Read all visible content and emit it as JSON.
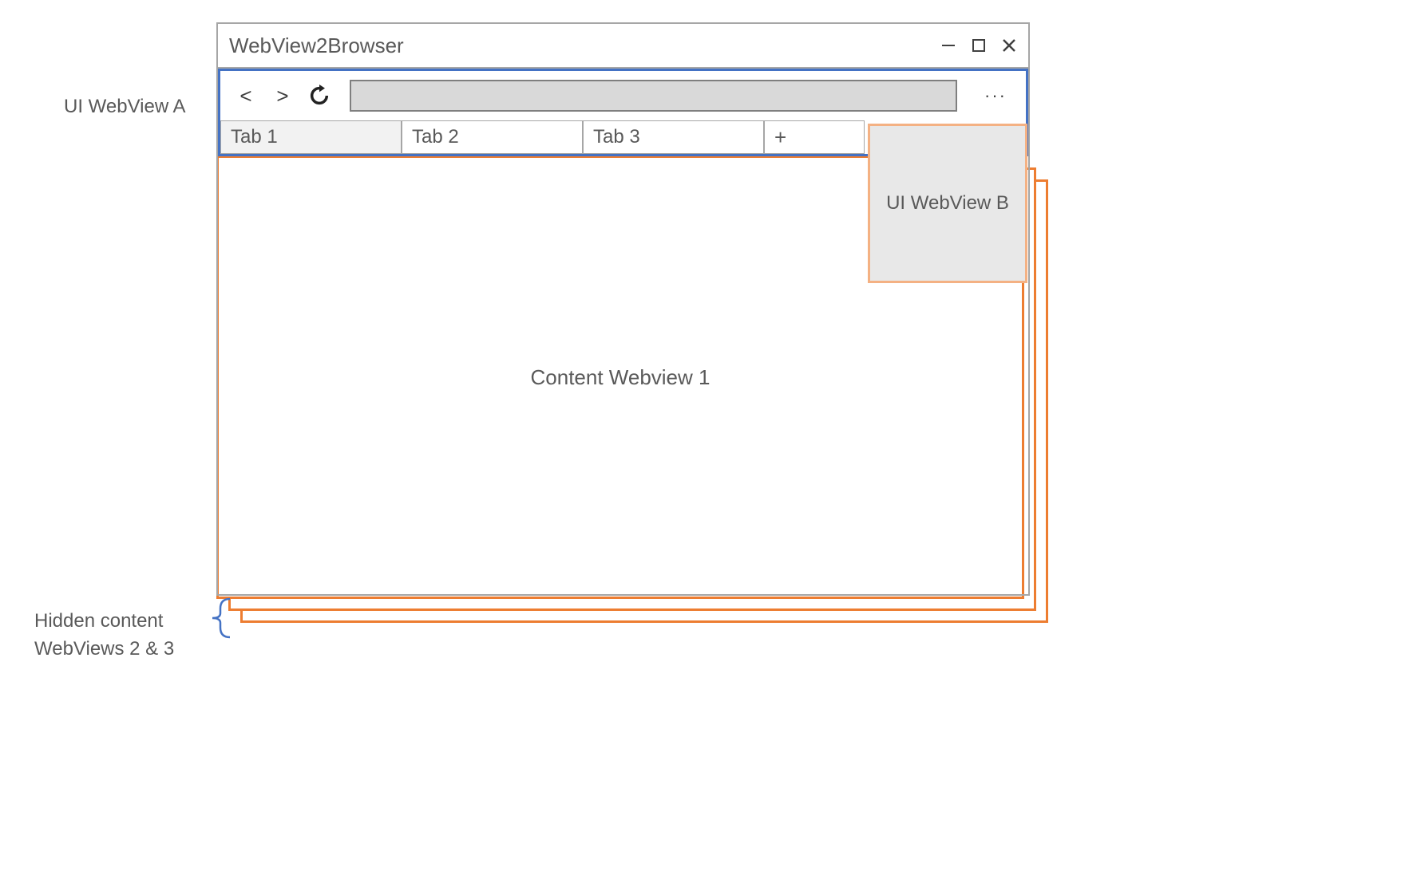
{
  "labels": {
    "ui_webview_a": "UI WebView A",
    "ui_webview_b": "UI WebView B",
    "hidden_content_line1": "Hidden content",
    "hidden_content_line2": "WebViews 2 & 3",
    "content_webview_1": "Content Webview 1"
  },
  "window": {
    "title": "WebView2Browser"
  },
  "navbar": {
    "back": "<",
    "forward": ">",
    "reload_icon": "reload-icon",
    "address_value": "",
    "more": "···"
  },
  "tabs": [
    {
      "label": "Tab 1",
      "active": true
    },
    {
      "label": "Tab 2",
      "active": false
    },
    {
      "label": "Tab 3",
      "active": false
    }
  ],
  "new_tab": "+",
  "colors": {
    "window_border": "#a6a6a6",
    "ui_a_border": "#4472c4",
    "content_border": "#ed7d31",
    "ui_b_border": "#f4b183",
    "addrbar_fill": "#d9d9d9"
  }
}
